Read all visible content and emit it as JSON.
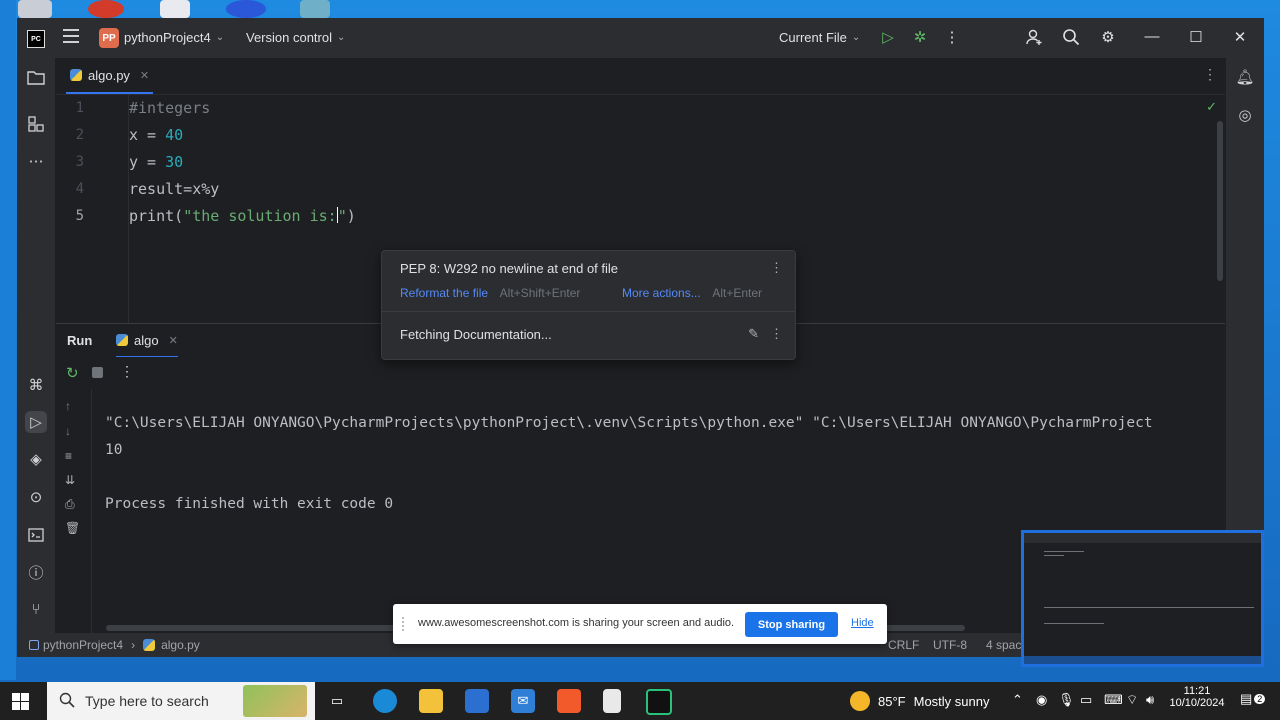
{
  "window": {
    "logo_text": "PC",
    "project_badge": "PP",
    "project_name": "pythonProject4",
    "version_control": "Version control",
    "run_config": "Current File"
  },
  "editor": {
    "tab_name": "algo.py",
    "lines": [
      {
        "num": "1",
        "text": "#integers"
      },
      {
        "num": "2",
        "var": "x",
        "op": " = ",
        "value": "40"
      },
      {
        "num": "3",
        "var": "y",
        "op": " = ",
        "value": "30"
      },
      {
        "num": "4",
        "text": "result=x%y"
      },
      {
        "num": "5",
        "func": "print(",
        "string": "\"the solution is:",
        "string_end": "\"",
        "close": ")"
      }
    ]
  },
  "popup": {
    "title": "PEP 8: W292 no newline at end of file",
    "action1": "Reformat the file",
    "shortcut1": "Alt+Shift+Enter",
    "action2": "More actions...",
    "shortcut2": "Alt+Enter",
    "doc_status": "Fetching Documentation..."
  },
  "run_panel": {
    "title": "Run",
    "tab_name": "algo",
    "output": [
      "\"C:\\Users\\ELIJAH ONYANGO\\PycharmProjects\\pythonProject\\.venv\\Scripts\\python.exe\" \"C:\\Users\\ELIJAH ONYANGO\\PycharmProject",
      "10",
      "",
      "Process finished with exit code 0"
    ]
  },
  "statusbar": {
    "breadcrumb_project": "pythonProject4",
    "breadcrumb_file": "algo.py",
    "line_ending": "CRLF",
    "encoding": "UTF-8",
    "indent": "4 spac"
  },
  "share_banner": {
    "message": "www.awesomescreenshot.com is sharing your screen and audio.",
    "stop_label": "Stop sharing",
    "hide_label": "Hide"
  },
  "taskbar": {
    "search_placeholder": "Type here to search",
    "weather_temp": "85°F",
    "weather_text": "Mostly sunny",
    "time": "11:21",
    "date": "10/10/2024",
    "notifications": "2"
  },
  "colors": {
    "accent": "#3574f0",
    "ide_bg": "#1e1f22",
    "panel_bg": "#2b2d30",
    "number": "#2aacb8",
    "string": "#6aab73",
    "comment": "#7a7e85",
    "link": "#548af7",
    "share_button": "#1a73e8"
  }
}
